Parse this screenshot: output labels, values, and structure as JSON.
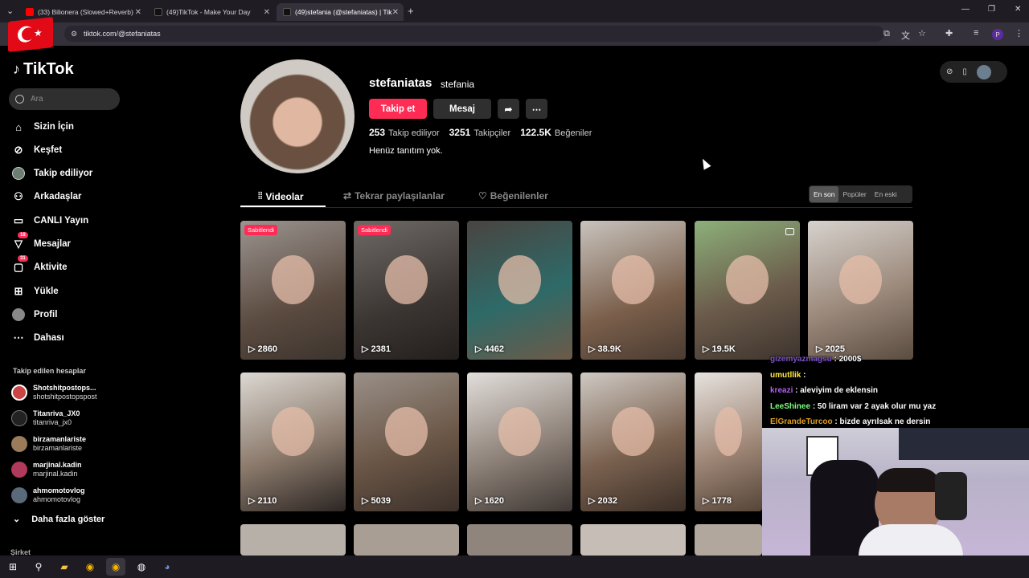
{
  "browser": {
    "tabs": [
      {
        "label": "(33) Bilionera (Slowed+Reverb)",
        "color": "#ff0000"
      },
      {
        "label": "(49)TikTok - Make Your Day",
        "color": "#000000"
      },
      {
        "label": "(49)stefania (@stefaniatas) | Tik",
        "color": "#000000"
      }
    ],
    "url": "tiktok.com/@stefaniatas",
    "profile_initial": "P"
  },
  "sidebar": {
    "logo": "TikTok",
    "search_placeholder": "Ara",
    "items": [
      {
        "label": "Sizin İçin",
        "icon": "home-icon"
      },
      {
        "label": "Keşfet",
        "icon": "compass-icon"
      },
      {
        "label": "Takip ediliyor",
        "icon": "following-icon"
      },
      {
        "label": "Arkadaşlar",
        "icon": "friends-icon"
      },
      {
        "label": "CANLI Yayın",
        "icon": "live-icon"
      },
      {
        "label": "Mesajlar",
        "icon": "messages-icon",
        "badge": "18"
      },
      {
        "label": "Aktivite",
        "icon": "activity-icon",
        "badge": "31"
      },
      {
        "label": "Yükle",
        "icon": "upload-icon"
      },
      {
        "label": "Profil",
        "icon": "profile-icon"
      },
      {
        "label": "Dahası",
        "icon": "more-icon"
      }
    ],
    "following_title": "Takip edilen hesaplar",
    "following": [
      {
        "name": "Shotshitpostops...",
        "handle": "shotshitpostopspost"
      },
      {
        "name": "Titanriva_JX0",
        "handle": "titanriva_jx0"
      },
      {
        "name": "birzamanlariste",
        "handle": "birzamanlariste"
      },
      {
        "name": "marjinal.kadin",
        "handle": "marjinal.kadin"
      },
      {
        "name": "ahmomotovlog",
        "handle": "ahmomotovlog"
      }
    ],
    "show_more": "Daha fazla göster",
    "footer": "Şirket"
  },
  "profile": {
    "username": "stefaniatas",
    "nickname": "stefania",
    "follow_button": "Takip et",
    "message_button": "Mesaj",
    "following_count": "253",
    "following_label": "Takip ediliyor",
    "followers_count": "3251",
    "followers_label": "Takipçiler",
    "likes_count": "122.5K",
    "likes_label": "Beğeniler",
    "bio": "Henüz tanıtım yok."
  },
  "tabs": [
    {
      "label": "Videolar",
      "icon": "grid-icon"
    },
    {
      "label": "Tekrar paylaşılanlar",
      "icon": "repost-icon"
    },
    {
      "label": "Beğenilenler",
      "icon": "heart-outline-icon"
    }
  ],
  "sort": [
    "En son",
    "Popüler",
    "En eski"
  ],
  "videos": [
    {
      "views": "2860",
      "pinned": "Sabitlendi"
    },
    {
      "views": "2381",
      "pinned": "Sabitlendi"
    },
    {
      "views": "4462"
    },
    {
      "views": "38.9K"
    },
    {
      "views": "19.5K"
    },
    {
      "views": "2025"
    },
    {
      "views": "2110"
    },
    {
      "views": "5039"
    },
    {
      "views": "1620"
    },
    {
      "views": "2032"
    },
    {
      "views": "1778"
    }
  ],
  "chat": [
    {
      "user": "gizemyazmagsu",
      "msg": ": 2000$"
    },
    {
      "user": "umutllik",
      "msg": ":"
    },
    {
      "user": "kreazi",
      "msg": ": aleviyim de eklensin"
    },
    {
      "user": "LeeShinee",
      "msg": ": 50 liram var 2 ayak olur mu yaz"
    },
    {
      "user": "ElGrandeTurcoo",
      "msg": ": bizde ayrılsak ne dersin"
    }
  ]
}
